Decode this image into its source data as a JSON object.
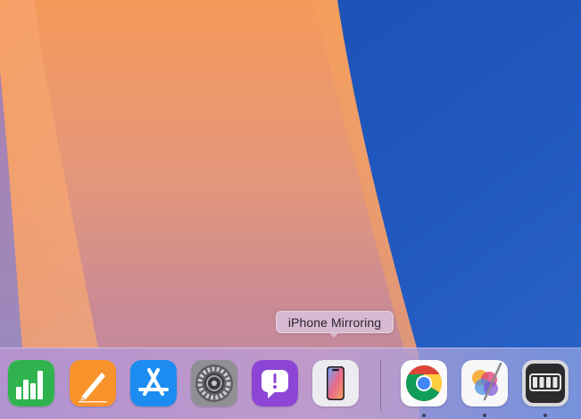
{
  "tooltip": {
    "text": "iPhone Mirroring"
  },
  "dock": {
    "items": [
      {
        "name": "numbers-icon",
        "color": "#2fb24c"
      },
      {
        "name": "pages-icon",
        "color": "#f7942a"
      },
      {
        "name": "app-store-icon",
        "color": "#1d8bf0"
      },
      {
        "name": "system-settings-icon",
        "color": "#8e8e93"
      },
      {
        "name": "feedback-assistant-icon",
        "color": "#8a44d0"
      },
      {
        "name": "iphone-mirroring-icon",
        "color": "#ececf0"
      },
      {
        "name": "chrome-icon",
        "color": "#ffffff"
      },
      {
        "name": "pixelmator-pro-icon",
        "color": "#ffffff"
      },
      {
        "name": "activity-monitor-icon",
        "color": "#2c2c2e"
      }
    ]
  },
  "wallpaper": {
    "colors": {
      "blue": "#1f56b8",
      "orange": "#f39a5e",
      "pink": "#c98a95",
      "purple": "#8e88c8"
    }
  }
}
